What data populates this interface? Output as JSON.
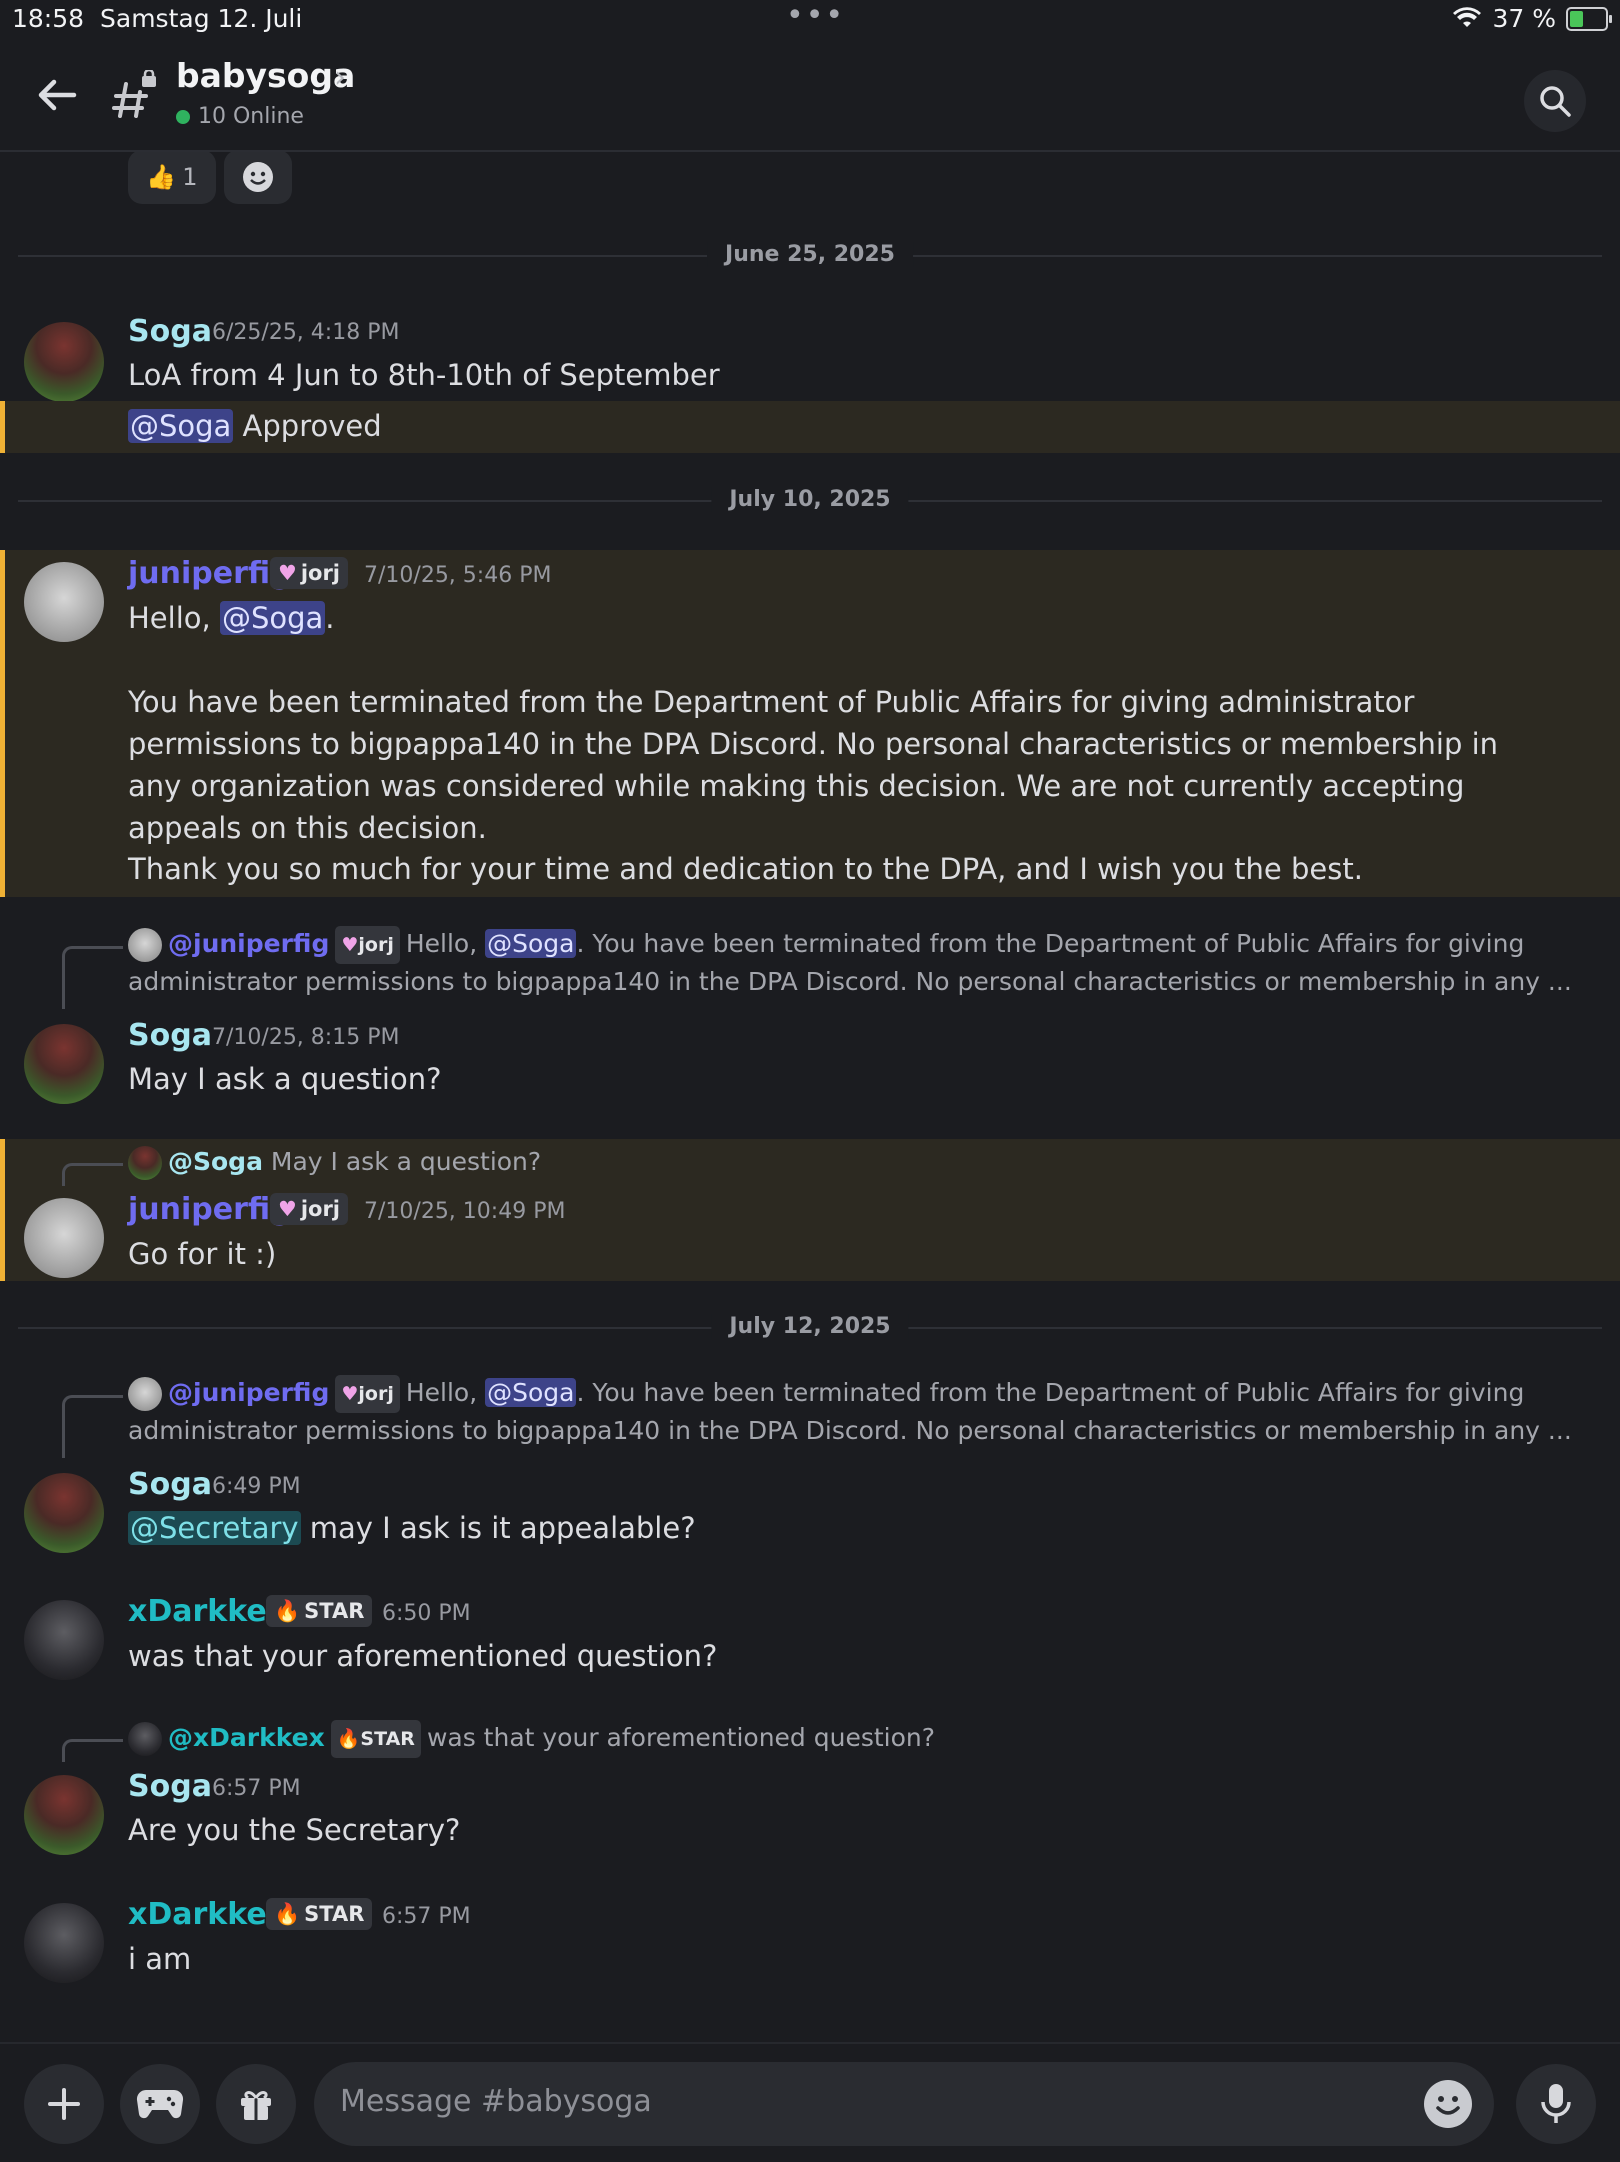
{
  "status_bar": {
    "time": "18:58",
    "date": "Samstag 12. Juli",
    "battery": "37 %",
    "battery_level": 0.37
  },
  "header": {
    "channel_name": "babysoga",
    "online": "10 Online"
  },
  "reactions": [
    {
      "emoji": "👍",
      "count": "1"
    }
  ],
  "dividers": [
    "June 25, 2025",
    "July 10, 2025",
    "July 12, 2025"
  ],
  "messages": {
    "m1": {
      "author": "Soga",
      "time": "6/25/25, 4:18 PM",
      "text": "LoA from 4 Jun to 8th-10th of September"
    },
    "m1b": {
      "mention": "@Soga",
      "text": " Approved"
    },
    "m2": {
      "author": "juniperfig",
      "tag": "jorj",
      "time": "7/10/25, 5:46 PM",
      "line1_pre": "Hello, ",
      "mention": "@Soga",
      "line1_post": ".",
      "para2": "You have been terminated from the Department of Public Affairs for giving administrator permissions to bigpappa140 in the DPA Discord. No personal characteristics or membership in any organization was considered while making this decision. We are not currently accepting appeals on this decision.",
      "para3": "Thank you so much for your time and dedication to the DPA, and I wish you the best."
    },
    "m3": {
      "reply_author": "@juniperfig",
      "reply_tag": "jorj",
      "reply_pre": "Hello, ",
      "reply_mention": "@Soga",
      "reply_text": ".  You have been terminated from the Department of Public Affairs for giving administrator permissions to bigpappa140 in the DPA Discord. No personal characteristics or membership in any ...",
      "author": "Soga",
      "time": "7/10/25, 8:15 PM",
      "text": "May I ask a question?"
    },
    "m4": {
      "reply_author": "@Soga",
      "reply_text": "May I ask a question?",
      "author": "juniperfig",
      "tag": "jorj",
      "time": "7/10/25, 10:49 PM",
      "text": "Go for it :)"
    },
    "m5": {
      "reply_author": "@juniperfig",
      "reply_tag": "jorj",
      "reply_pre": "Hello, ",
      "reply_mention": "@Soga",
      "reply_text": ".  You have been terminated from the Department of Public Affairs for giving administrator permissions to bigpappa140 in the DPA Discord. No personal characteristics or membership in any ...",
      "author": "Soga",
      "time": "6:49 PM",
      "mention": "@Secretary",
      "text": " may I ask is it appealable?"
    },
    "m6": {
      "author": "xDarkkex",
      "tag": "STAR",
      "time": "6:50 PM",
      "text": "was that your aforementioned question?"
    },
    "m7": {
      "reply_author": "@xDarkkex",
      "reply_tag": "STAR",
      "reply_text": "was that your aforementioned question?",
      "author": "Soga",
      "time": "6:57 PM",
      "text": "Are you the Secretary?"
    },
    "m8": {
      "author": "xDarkkex",
      "tag": "STAR",
      "time": "6:57 PM",
      "text": "i am"
    }
  },
  "composer": {
    "placeholder": "Message #babysoga"
  }
}
